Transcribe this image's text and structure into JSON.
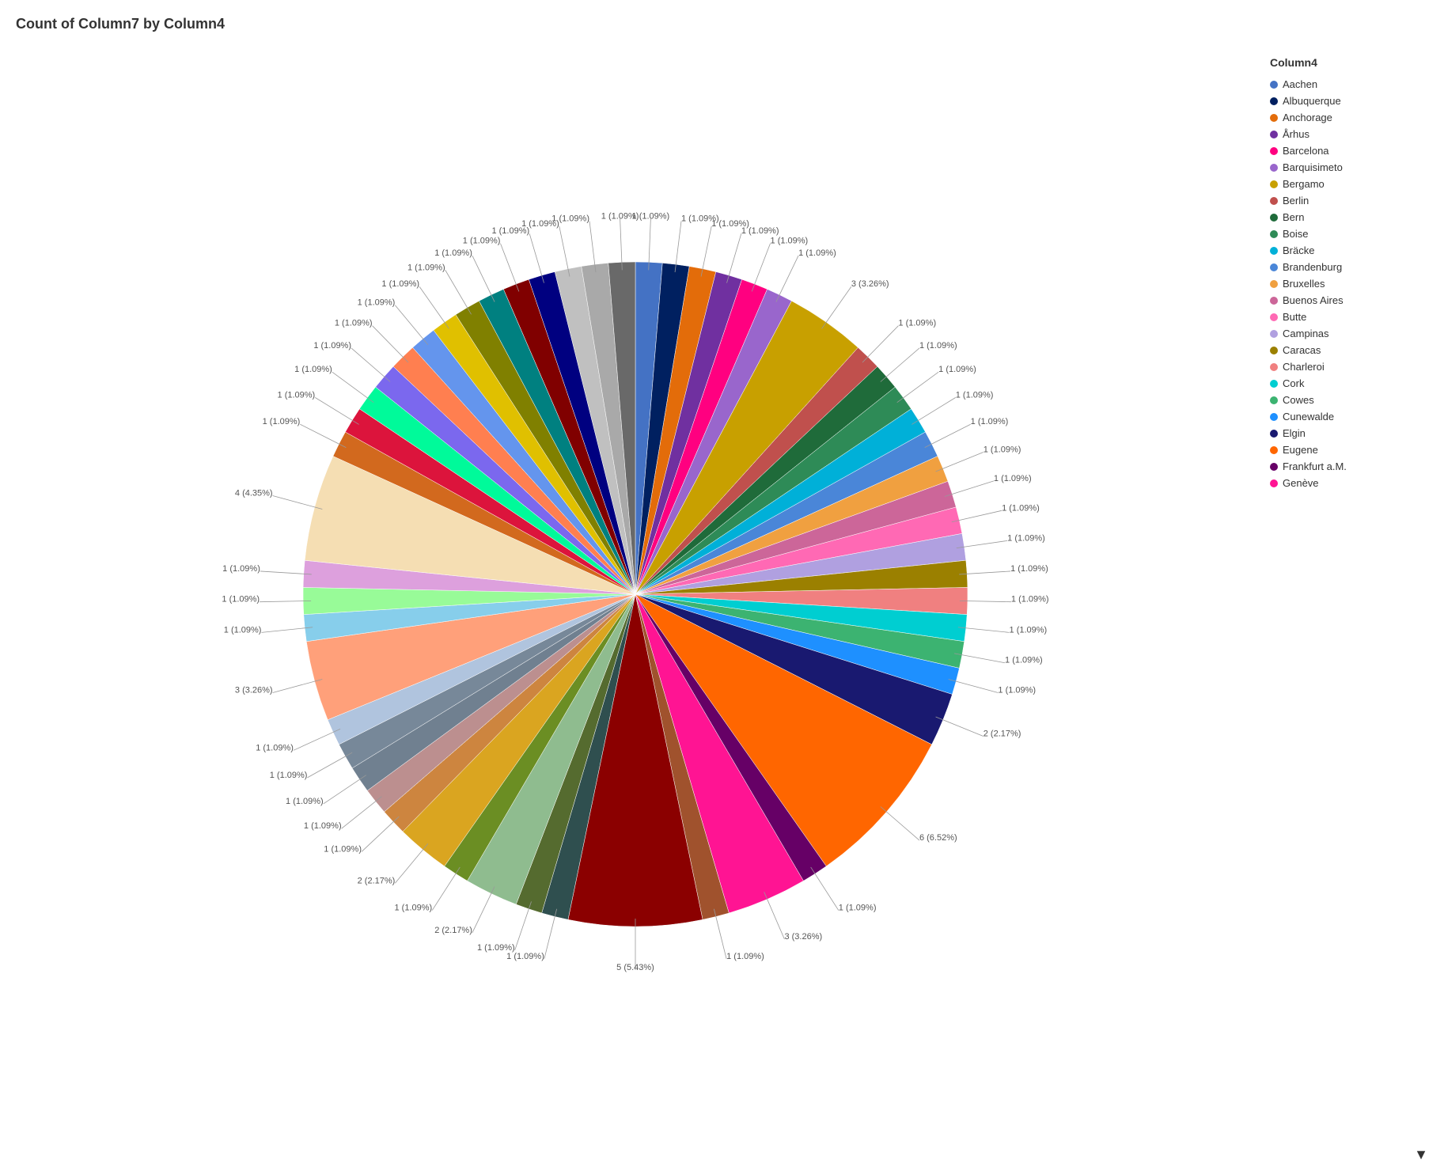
{
  "title": "Count of Column7 by Column4",
  "legend": {
    "title": "Column4",
    "items": [
      {
        "label": "Aachen",
        "color": "#4472C4"
      },
      {
        "label": "Albuquerque",
        "color": "#002060"
      },
      {
        "label": "Anchorage",
        "color": "#E36C0A"
      },
      {
        "label": "Århus",
        "color": "#7030A0"
      },
      {
        "label": "Barcelona",
        "color": "#FF0080"
      },
      {
        "label": "Barquisimeto",
        "color": "#9966CC"
      },
      {
        "label": "Bergamo",
        "color": "#C8A000"
      },
      {
        "label": "Berlin",
        "color": "#C0504D"
      },
      {
        "label": "Bern",
        "color": "#1F6B3A"
      },
      {
        "label": "Boise",
        "color": "#2E8B57"
      },
      {
        "label": "Bräcke",
        "color": "#00B0D8"
      },
      {
        "label": "Brandenburg",
        "color": "#4A86D8"
      },
      {
        "label": "Bruxelles",
        "color": "#F0A040"
      },
      {
        "label": "Buenos Aires",
        "color": "#CC6699"
      },
      {
        "label": "Butte",
        "color": "#FF69B4"
      },
      {
        "label": "Campinas",
        "color": "#B0A0E0"
      },
      {
        "label": "Caracas",
        "color": "#9B8000"
      },
      {
        "label": "Charleroi",
        "color": "#F08080"
      },
      {
        "label": "Cork",
        "color": "#00CED1"
      },
      {
        "label": "Cowes",
        "color": "#3CB371"
      },
      {
        "label": "Cunewalde",
        "color": "#1E90FF"
      },
      {
        "label": "Elgin",
        "color": "#191970"
      },
      {
        "label": "Eugene",
        "color": "#FF6600"
      },
      {
        "label": "Frankfurt a.M.",
        "color": "#660066"
      },
      {
        "label": "Genève",
        "color": "#FF1493"
      }
    ]
  },
  "pie": {
    "slices": [
      {
        "label": "1 (1.09%)",
        "color": "#4472C4",
        "value": 1,
        "startAngle": 0,
        "endAngle": 3.93
      },
      {
        "label": "1 (1.09%)",
        "color": "#002060",
        "value": 1,
        "startAngle": 3.93,
        "endAngle": 7.86
      },
      {
        "label": "1 (1.09%)",
        "color": "#E36C0A",
        "value": 1,
        "startAngle": 7.86,
        "endAngle": 11.79
      },
      {
        "label": "1 (1.09%)",
        "color": "#7030A0",
        "value": 1
      },
      {
        "label": "1 (1.09%)",
        "color": "#FF0080",
        "value": 1
      },
      {
        "label": "1 (1.09%)",
        "color": "#9966CC",
        "value": 1
      },
      {
        "label": "3 (3.26%)",
        "color": "#C8A000",
        "value": 3
      },
      {
        "label": "1 (1.09%)",
        "color": "#C0504D",
        "value": 1
      },
      {
        "label": "1 (1.09%)",
        "color": "#1F6B3A",
        "value": 1
      },
      {
        "label": "1 (1.09%)",
        "color": "#2E8B57",
        "value": 1
      },
      {
        "label": "1 (1.09%)",
        "color": "#00B0D8",
        "value": 1
      },
      {
        "label": "1 (1.09%)",
        "color": "#4A86D8",
        "value": 1
      },
      {
        "label": "1 (1.09%)",
        "color": "#F0A040",
        "value": 1
      },
      {
        "label": "1 (1.09%)",
        "color": "#CC6699",
        "value": 1
      },
      {
        "label": "1 (1.09%)",
        "color": "#FF69B4",
        "value": 1
      },
      {
        "label": "1 (1.09%)",
        "color": "#B0A0E0",
        "value": 1
      },
      {
        "label": "1 (1.09%)",
        "color": "#9B8000",
        "value": 1
      },
      {
        "label": "1 (1.09%)",
        "color": "#F08080",
        "value": 1
      },
      {
        "label": "1 (1.09%)",
        "color": "#00CED1",
        "value": 1
      },
      {
        "label": "1 (1.09%)",
        "color": "#3CB371",
        "value": 1
      },
      {
        "label": "1 (1.09%)",
        "color": "#1E90FF",
        "value": 1
      },
      {
        "label": "2 (2.17%)",
        "color": "#191970",
        "value": 2
      },
      {
        "label": "6 (6.52%)",
        "color": "#FF6600",
        "value": 6
      },
      {
        "label": "1 (1.09%)",
        "color": "#660066",
        "value": 1
      },
      {
        "label": "3 (3.26%)",
        "color": "#FF1493",
        "value": 3
      },
      {
        "label": "1 (1.09%)",
        "color": "#A0522D",
        "value": 1
      },
      {
        "label": "5 (5.43%)",
        "color": "#8B0000",
        "value": 5
      },
      {
        "label": "1 (1.09%)",
        "color": "#2F4F4F",
        "value": 1
      },
      {
        "label": "1 (1.09%)",
        "color": "#556B2F",
        "value": 1
      },
      {
        "label": "2 (2.17%)",
        "color": "#8FBC8F",
        "value": 2
      },
      {
        "label": "1 (1.09%)",
        "color": "#6B8E23",
        "value": 1
      },
      {
        "label": "2 (2.17%)",
        "color": "#DAA520",
        "value": 2
      },
      {
        "label": "1 (1.09%)",
        "color": "#CD853F",
        "value": 1
      },
      {
        "label": "1 (1.09%)",
        "color": "#BC8F8F",
        "value": 1
      },
      {
        "label": "1 (1.09%)",
        "color": "#708090",
        "value": 1
      },
      {
        "label": "1 (1.09%)",
        "color": "#778899",
        "value": 1
      },
      {
        "label": "1 (1.09%)",
        "color": "#B0C4DE",
        "value": 1
      },
      {
        "label": "3 (3.26%)",
        "color": "#FFA07A",
        "value": 3
      },
      {
        "label": "1 (1.09%)",
        "color": "#87CEEB",
        "value": 1
      },
      {
        "label": "1 (1.09%)",
        "color": "#98FB98",
        "value": 1
      },
      {
        "label": "1 (1.09%)",
        "color": "#DDA0DD",
        "value": 1
      },
      {
        "label": "4 (4.35%)",
        "color": "#F5DEB3",
        "value": 4
      },
      {
        "label": "1 (1.09%)",
        "color": "#D2691E",
        "value": 1
      },
      {
        "label": "1 (1.09%)",
        "color": "#DC143C",
        "value": 1
      },
      {
        "label": "1 (1.09%)",
        "color": "#00FA9A",
        "value": 1
      },
      {
        "label": "1 (1.09%)",
        "color": "#7B68EE",
        "value": 1
      },
      {
        "label": "1 (1.09%)",
        "color": "#FF7F50",
        "value": 1
      },
      {
        "label": "1 (1.09%)",
        "color": "#6495ED",
        "value": 1
      },
      {
        "label": "1 (1.09%)",
        "color": "#E0E090",
        "value": 1
      },
      {
        "label": "1 (1.09%)",
        "color": "#808000",
        "value": 1
      },
      {
        "label": "1 (1.09%)",
        "color": "#008080",
        "value": 1
      },
      {
        "label": "1 (1.09%)",
        "color": "#800000",
        "value": 1
      },
      {
        "label": "1 (1.09%)",
        "color": "#000080",
        "value": 1
      },
      {
        "label": "1 (1.09%)",
        "color": "#C0C0C0",
        "value": 1
      },
      {
        "label": "1 (1.09%)",
        "color": "#A9A9A9",
        "value": 1
      },
      {
        "label": "1 (1.09%)",
        "color": "#696969",
        "value": 1
      }
    ]
  }
}
